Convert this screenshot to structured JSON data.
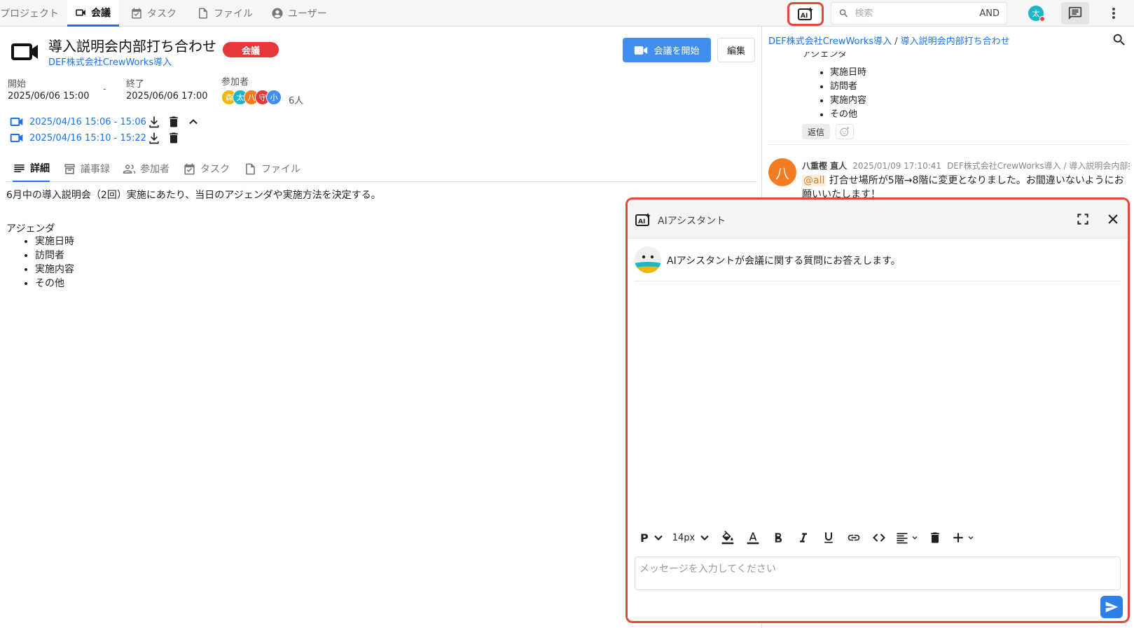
{
  "nav": {
    "tabs": [
      {
        "label": "プロジェクト",
        "icon": "project-icon"
      },
      {
        "label": "会議",
        "icon": "video-icon"
      },
      {
        "label": "タスク",
        "icon": "task-icon"
      },
      {
        "label": "ファイル",
        "icon": "file-icon"
      },
      {
        "label": "ユーザー",
        "icon": "user-icon"
      }
    ],
    "search_placeholder": "検索",
    "search_mode": "AND",
    "user_avatar": "太"
  },
  "meeting": {
    "title": "導入説明会内部打ち合わせ",
    "badge": "会議",
    "project": "DEF株式会社CrewWorks導入",
    "start_button": "会議を開始",
    "edit_button": "編集",
    "start_label": "開始",
    "start_value": "2025/06/06 15:00",
    "dash": "-",
    "end_label": "終了",
    "end_value": "2025/06/06 17:00",
    "participants_label": "参加者",
    "participants": [
      {
        "initial": "森",
        "color": "#f2b705"
      },
      {
        "initial": "太",
        "color": "#1fb6c9"
      },
      {
        "initial": "八",
        "color": "#f47c20"
      },
      {
        "initial": "守",
        "color": "#e8373b"
      },
      {
        "initial": "小",
        "color": "#3f8ef0"
      }
    ],
    "participants_count": "6人",
    "recordings": [
      "2025/04/16 15:06 - 15:06",
      "2025/04/16 15:10 - 15:22"
    ]
  },
  "tabs": [
    {
      "label": "詳細"
    },
    {
      "label": "議事録"
    },
    {
      "label": "参加者"
    },
    {
      "label": "タスク"
    },
    {
      "label": "ファイル"
    }
  ],
  "detail": {
    "description": "6月中の導入説明会（2回）実施にあたり、当日のアジェンダや実施方法を決定する。",
    "agenda_title": "アジェンダ",
    "agenda_items": [
      "実施日時",
      "訪問者",
      "実施内容",
      "その他"
    ]
  },
  "right": {
    "breadcrumb_project": "DEF株式会社CrewWorks導入",
    "breadcrumb_sep": "/",
    "breadcrumb_meeting": "導入説明会内部打ち合わせ",
    "agenda_title": "アジェンダ",
    "agenda_items": [
      "実施日時",
      "訪問者",
      "実施内容",
      "その他"
    ],
    "reply_label": "返信",
    "message": {
      "avatar": "八",
      "name": "八重樫 直人",
      "timestamp": "2025/01/09 17:10:41",
      "context": "DEF株式会社CrewWorks導入 / 導入説明会内部打...",
      "mention": "@all",
      "text": " 打合せ場所が5階→8階に変更となりました。お間違いないようにお願いいたします！"
    }
  },
  "ai": {
    "title": "AIアシスタント",
    "welcome": "AIアシスタントが会議に関する質問にお答えします。",
    "toolbar": {
      "block": "P",
      "font_size": "14px"
    },
    "input_placeholder": "メッセージを入力してください"
  },
  "colors": {
    "accent": "#1a73e8",
    "highlight_border": "#e04a3c",
    "badge": "#e8373b"
  }
}
